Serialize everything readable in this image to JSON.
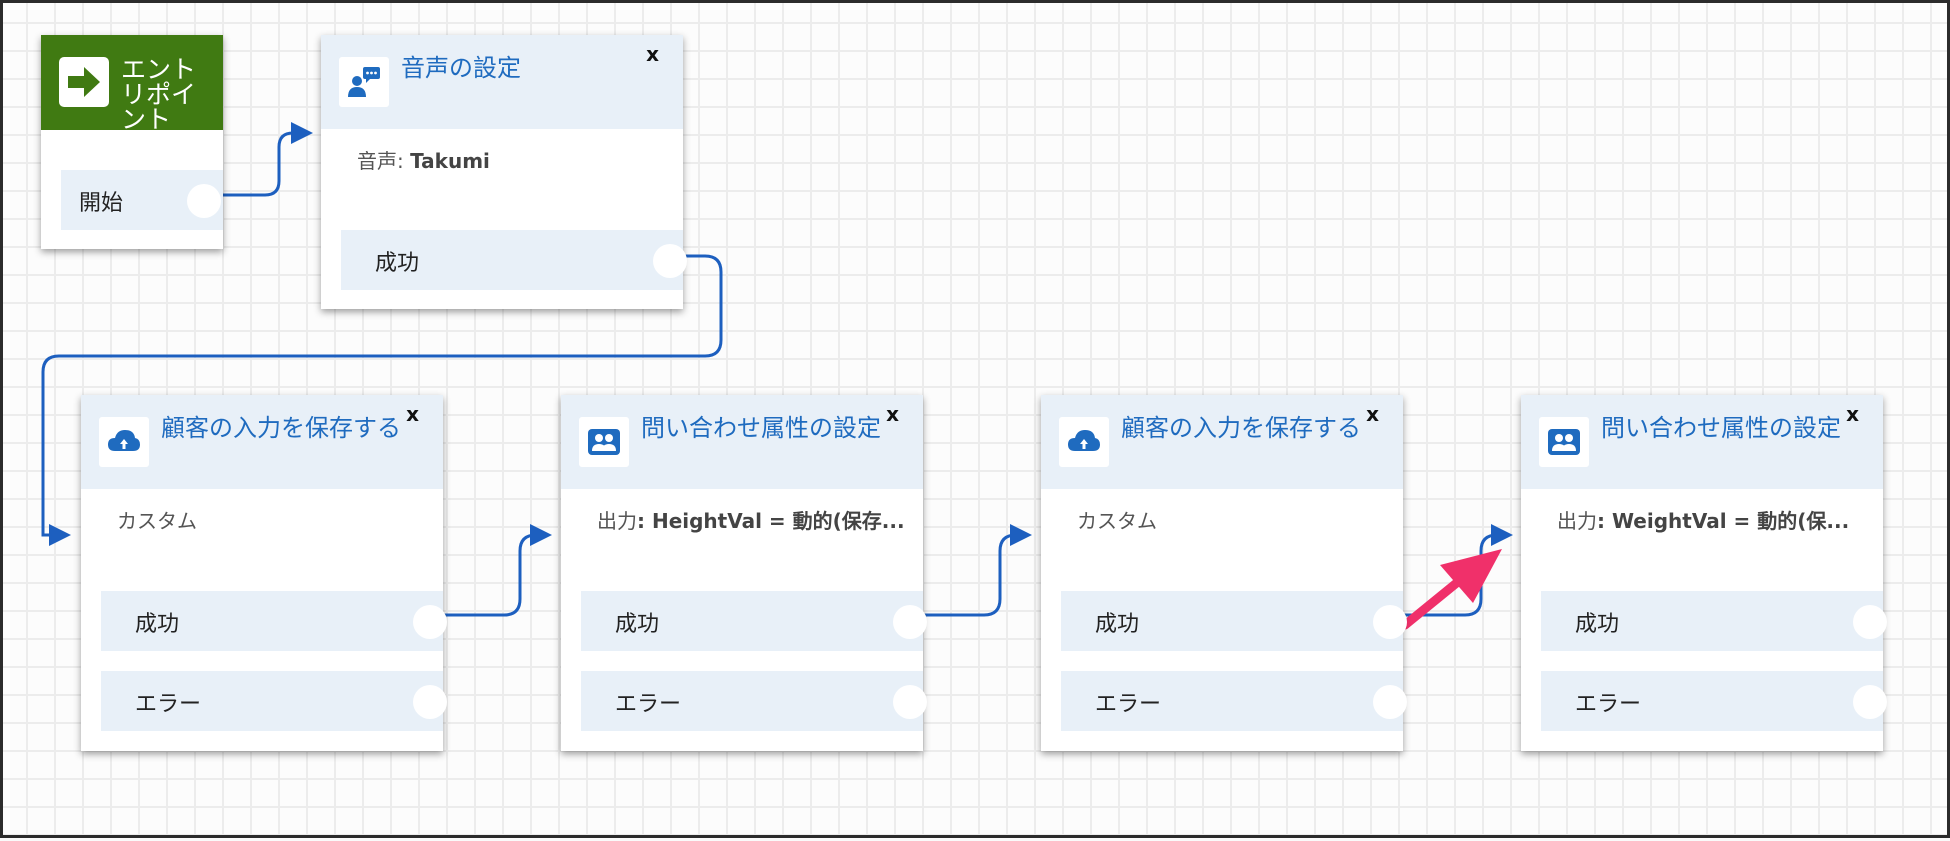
{
  "entry": {
    "title": "エントリポイント",
    "branch": "開始"
  },
  "blocks": [
    {
      "title": "音声の設定",
      "close": "x",
      "body_label": "音声: ",
      "body_value": "Takumi",
      "branches": [
        "成功"
      ],
      "icon": "voice-settings-icon"
    },
    {
      "title": "顧客の入力を保存する",
      "close": "x",
      "body_label": "カスタム",
      "body_value": "",
      "branches": [
        "成功",
        "エラー"
      ],
      "icon": "cloud-icon"
    },
    {
      "title": "問い合わせ属性の設定",
      "close": "x",
      "body_label": "出力",
      "body_value": ": HeightVal = 動的(保存...",
      "branches": [
        "成功",
        "エラー"
      ],
      "icon": "people-icon"
    },
    {
      "title": "顧客の入力を保存する",
      "close": "x",
      "body_label": "カスタム",
      "body_value": "",
      "branches": [
        "成功",
        "エラー"
      ],
      "icon": "cloud-icon"
    },
    {
      "title": "問い合わせ属性の設定",
      "close": "x",
      "body_label": "出力",
      "body_value": ": WeightVal = 動的(保...",
      "branches": [
        "成功",
        "エラー"
      ],
      "icon": "people-icon"
    }
  ],
  "colors": {
    "accent": "#1f6bbf",
    "wire": "#1d5fbf",
    "entry": "#407a12",
    "annotation_arrow": "#f0306a"
  }
}
